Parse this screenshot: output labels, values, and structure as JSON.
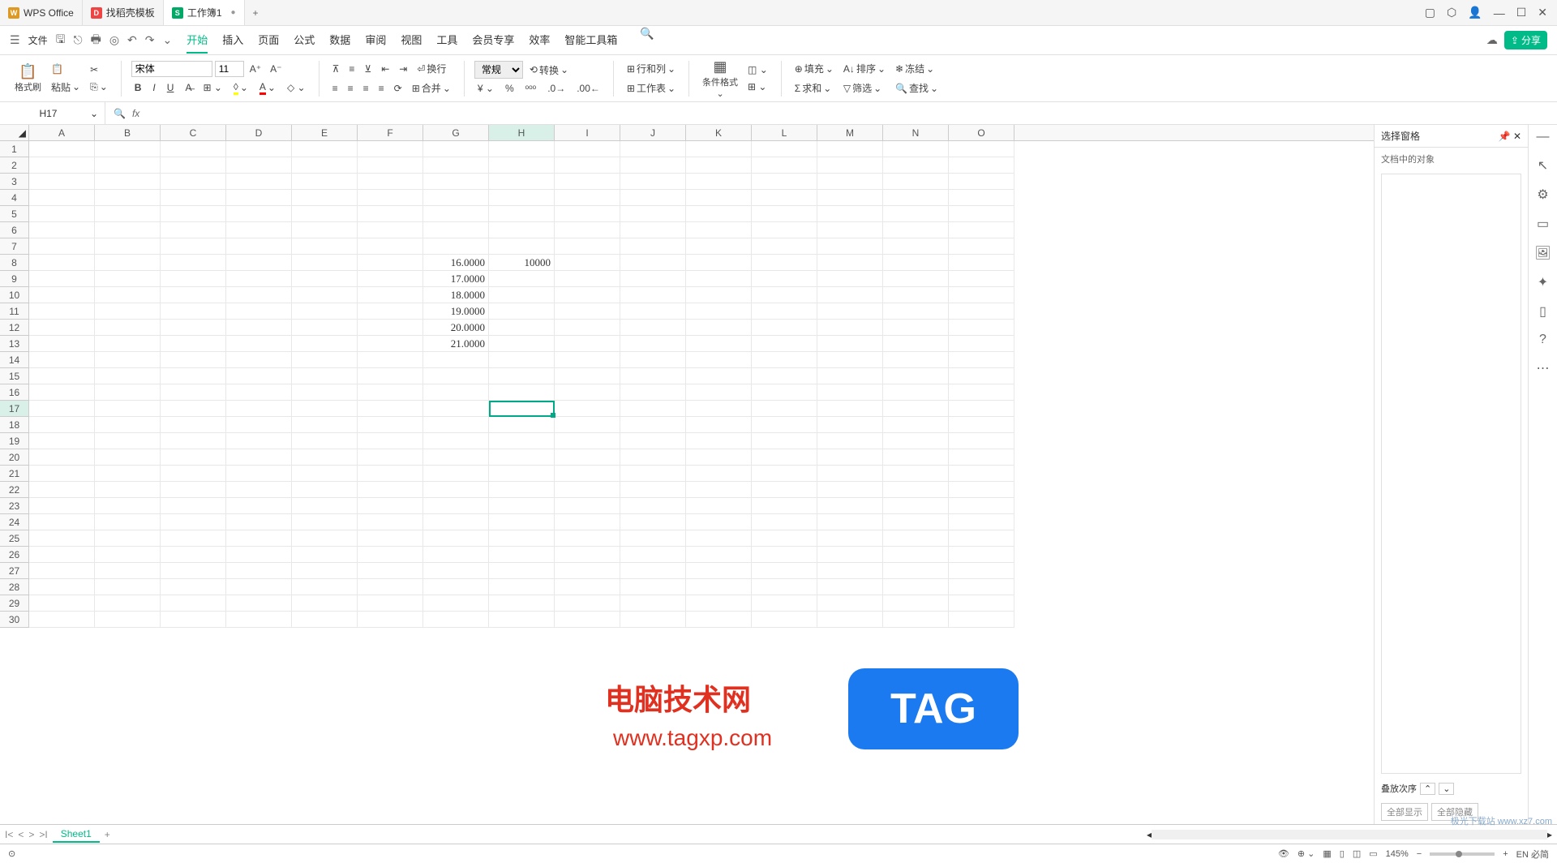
{
  "titlebar": {
    "tabs": [
      {
        "label": "WPS Office",
        "icon_bg": "#d92",
        "icon_text": "W"
      },
      {
        "label": "找稻壳模板",
        "icon_bg": "#e44",
        "icon_text": "D"
      },
      {
        "label": "工作簿1",
        "icon_bg": "#0a6",
        "icon_text": "S",
        "active": true
      }
    ],
    "new_tab": "+"
  },
  "menubar": {
    "file_label": "文件",
    "tabs": [
      "开始",
      "插入",
      "页面",
      "公式",
      "数据",
      "审阅",
      "视图",
      "工具",
      "会员专享",
      "效率",
      "智能工具箱"
    ],
    "active_tab": "开始",
    "share_label": "分享"
  },
  "ribbon": {
    "format_painter": "格式刷",
    "paste": "粘贴",
    "font_name": "宋体",
    "font_size": "11",
    "wrap": "换行",
    "merge": "合并",
    "number_format": "常规",
    "convert": "转换",
    "row_col": "行和列",
    "worksheet": "工作表",
    "cond_format": "条件格式",
    "fill": "填充",
    "sort": "排序",
    "freeze": "冻结",
    "sum": "求和",
    "filter": "筛选",
    "find": "查找"
  },
  "namebox": {
    "cell_ref": "H17"
  },
  "grid": {
    "columns": [
      "A",
      "B",
      "C",
      "D",
      "E",
      "F",
      "G",
      "H",
      "I",
      "J",
      "K",
      "L",
      "M",
      "N",
      "O"
    ],
    "active_col_index": 7,
    "row_count": 30,
    "active_row": 17,
    "cells": {
      "G8": "16.0000",
      "H8": "10000",
      "G9": "17.0000",
      "G10": "18.0000",
      "G11": "19.0000",
      "G12": "20.0000",
      "G13": "21.0000"
    }
  },
  "right_panel": {
    "title": "选择窗格",
    "subtitle": "文档中的对象",
    "stack_label": "叠放次序",
    "show_all": "全部显示",
    "hide_all": "全部隐藏"
  },
  "sheet_tabs": {
    "active": "Sheet1"
  },
  "statusbar": {
    "zoom": "145%",
    "ime": "EN 必简"
  },
  "watermarks": {
    "wm1": "电脑技术网",
    "wm2": "www.tagxp.com",
    "tag": "TAG",
    "corner": "极光下载站 www.xz7.com"
  }
}
